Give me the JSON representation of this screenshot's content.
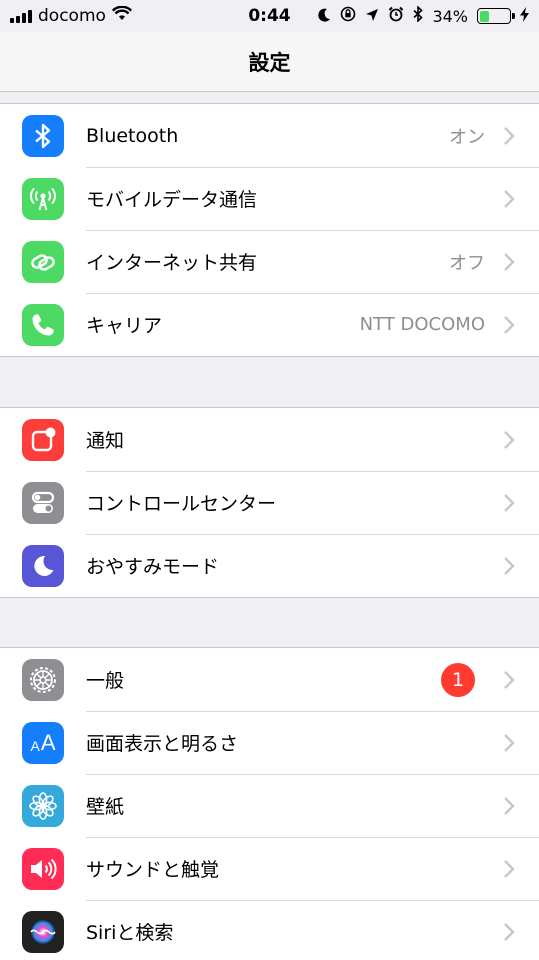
{
  "status_bar": {
    "carrier": "docomo",
    "time": "0:44",
    "battery_percent": "34%",
    "battery_level": 0.34,
    "icons": [
      "signal-icon",
      "wifi-icon",
      "moon-icon",
      "orientation-lock-icon",
      "location-icon",
      "alarm-icon",
      "bluetooth-icon",
      "battery-icon",
      "charging-icon"
    ]
  },
  "nav": {
    "title": "設定"
  },
  "groups": [
    {
      "rows": [
        {
          "label": "Bluetooth",
          "value": "オン",
          "icon": "bluetooth-icon",
          "color": "#147efb"
        },
        {
          "label": "モバイルデータ通信",
          "value": "",
          "icon": "antenna-icon",
          "color": "#4cd964"
        },
        {
          "label": "インターネット共有",
          "value": "オフ",
          "icon": "hotspot-link-icon",
          "color": "#4cd964"
        },
        {
          "label": "キャリア",
          "value": "NTT DOCOMO",
          "icon": "phone-icon",
          "color": "#4cd964"
        }
      ]
    },
    {
      "rows": [
        {
          "label": "通知",
          "value": "",
          "icon": "notifications-icon",
          "color": "#fc3d39"
        },
        {
          "label": "コントロールセンター",
          "value": "",
          "icon": "control-center-icon",
          "color": "#8e8e93"
        },
        {
          "label": "おやすみモード",
          "value": "",
          "icon": "moon-icon",
          "color": "#5856d6"
        }
      ]
    },
    {
      "rows": [
        {
          "label": "一般",
          "value": "",
          "badge": "1",
          "icon": "gear-icon",
          "color": "#8e8e93"
        },
        {
          "label": "画面表示と明るさ",
          "value": "",
          "icon": "text-size-icon",
          "color": "#147efb"
        },
        {
          "label": "壁紙",
          "value": "",
          "icon": "flower-icon",
          "color": "#34aadc"
        },
        {
          "label": "サウンドと触覚",
          "value": "",
          "icon": "speaker-icon",
          "color": "#ff2d55"
        },
        {
          "label": "Siriと検索",
          "value": "",
          "icon": "siri-icon",
          "color": "#222222"
        }
      ]
    }
  ]
}
